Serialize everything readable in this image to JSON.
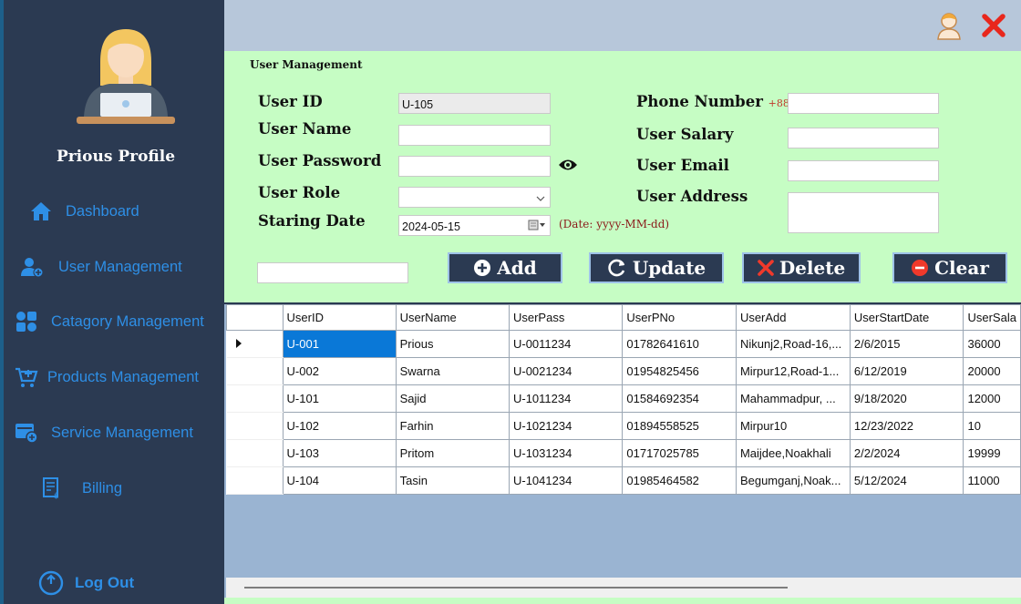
{
  "sidebar": {
    "profile_name": "Prious  Profile",
    "items": [
      {
        "label": "Dashboard",
        "icon": "home-icon"
      },
      {
        "label": "User Management",
        "icon": "add-user-icon"
      },
      {
        "label": "Catagory Management",
        "icon": "category-icon"
      },
      {
        "label": "Products Management",
        "icon": "cart-icon"
      },
      {
        "label": "Service Management",
        "icon": "service-icon"
      },
      {
        "label": "Billing",
        "icon": "bill-icon"
      }
    ],
    "logout_label": "Log Out"
  },
  "topbar": {
    "icons": [
      "profile-icon",
      "close-icon"
    ]
  },
  "form": {
    "title": "User Management",
    "labels": {
      "user_id": "User ID",
      "user_name": "User Name",
      "user_password": "User Password",
      "user_role": "User Role",
      "start_date": "Staring Date",
      "phone": "Phone Number",
      "phone_prefix": "+88",
      "salary": "User Salary",
      "email": "User Email",
      "address": "User Address"
    },
    "values": {
      "user_id": "U-105",
      "user_name": "",
      "user_password": "",
      "user_role": "",
      "start_date": "2024-05-15",
      "phone": "",
      "salary": "",
      "email": "",
      "address": "",
      "search": ""
    },
    "date_hint": "(Date: yyyy-MM-dd)",
    "buttons": {
      "add": "Add",
      "update": "Update",
      "delete": "Delete",
      "clear": "Clear"
    }
  },
  "grid": {
    "columns": [
      "UserID",
      "UserName",
      "UserPass",
      "UserPNo",
      "UserAdd",
      "UserStartDate",
      "UserSala"
    ],
    "rows": [
      [
        "U-001",
        "Prious",
        "U-0011234",
        "01782641610",
        "Nikunj2,Road-16,...",
        "2/6/2015",
        "36000"
      ],
      [
        "U-002",
        "Swarna",
        "U-0021234",
        "01954825456",
        "Mirpur12,Road-1...",
        "6/12/2019",
        "20000"
      ],
      [
        "U-101",
        "Sajid",
        "U-1011234",
        "01584692354",
        "Mahammadpur, ...",
        "9/18/2020",
        "12000"
      ],
      [
        "U-102",
        "Farhin",
        "U-1021234",
        "01894558525",
        "Mirpur10",
        "12/23/2022",
        "10"
      ],
      [
        "U-103",
        "Pritom",
        "U-1031234",
        "01717025785",
        "Maijdee,Noakhali",
        "2/2/2024",
        "19999"
      ],
      [
        "U-104",
        "Tasin",
        "U-1041234",
        "01985464582",
        "Begumganj,Noak...",
        "5/12/2024",
        "11000"
      ]
    ]
  },
  "colors": {
    "sidebar_bg": "#2b3a52",
    "nav_text": "#2e8fe6",
    "form_bg": "#c6fdc4",
    "topbar_bg": "#b7c7da",
    "grid_bg": "#9ab4d2",
    "selection": "#0a78d7",
    "close_red": "#e8271c"
  }
}
